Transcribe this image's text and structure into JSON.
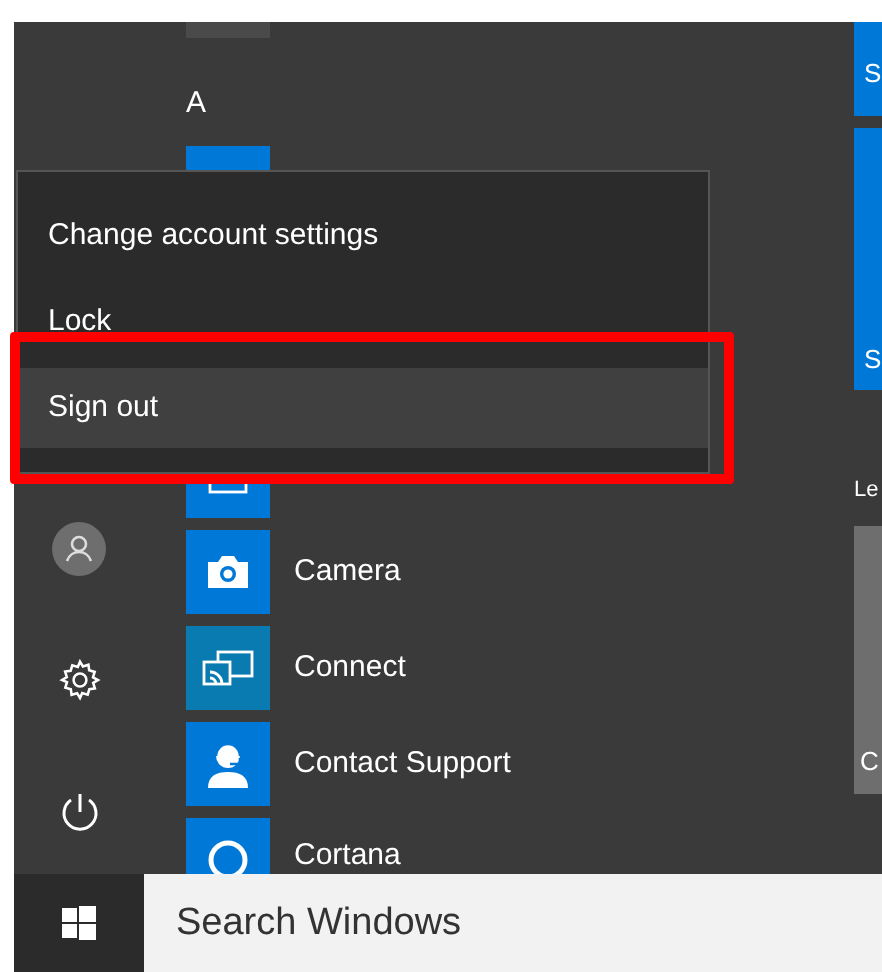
{
  "rail": [
    {
      "kind": "user"
    },
    {
      "kind": "settings"
    },
    {
      "kind": "power"
    }
  ],
  "apps": {
    "section_letter": "A",
    "items": [
      {
        "kind": "cut-top",
        "color": "#4a4a4a"
      },
      {
        "kind": "covered-a",
        "color": "#0078d7"
      },
      {
        "kind": "hidden"
      },
      {
        "kind": "hidden"
      },
      {
        "kind": "calendar",
        "color": "#0078d7"
      },
      {
        "kind": "camera",
        "label": "Camera",
        "color": "#0078d7"
      },
      {
        "kind": "connect",
        "label": "Connect",
        "color": "#0a7bb0"
      },
      {
        "kind": "support",
        "label": "Contact Support",
        "color": "#0078d7"
      },
      {
        "kind": "cortana",
        "label": "Cortana",
        "color": "#0078d7"
      }
    ]
  },
  "tiles": {
    "group_label": "Le",
    "items": [
      {
        "text": "S",
        "color": "#0078d7"
      },
      {
        "text": "S",
        "color": "#0078d7"
      }
    ],
    "big": {
      "text": "C",
      "color": "#6e6e6e"
    }
  },
  "account_menu": {
    "items": [
      {
        "label": "Change account settings",
        "selected": false
      },
      {
        "label": "Lock",
        "selected": false
      },
      {
        "label": "Sign out",
        "selected": true
      }
    ],
    "highlighted": true
  },
  "taskbar": {
    "search": {
      "placeholder": "Search Windows"
    }
  }
}
